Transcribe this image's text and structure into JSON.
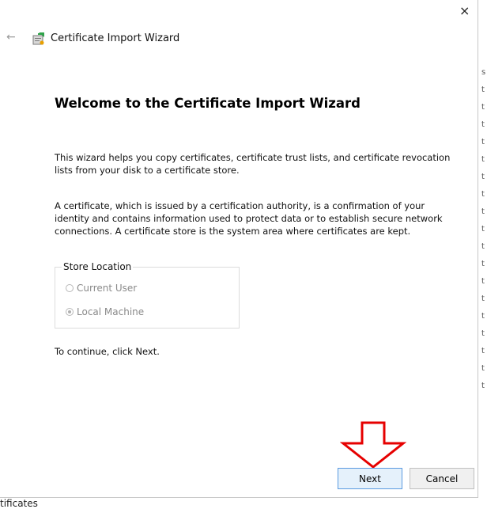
{
  "window": {
    "close_label": "×",
    "back_label": "←",
    "title": "Certificate Import Wizard"
  },
  "content": {
    "heading": "Welcome to the Certificate Import Wizard",
    "para1": "This wizard helps you copy certificates, certificate trust lists, and certificate revocation lists from your disk to a certificate store.",
    "para2": "A certificate, which is issued by a certification authority, is a confirmation of your identity and contains information used to protect data or to establish secure network connections. A certificate store is the system area where certificates are kept.",
    "store_location": {
      "legend": "Store Location",
      "options": [
        {
          "label": "Current User",
          "checked": false,
          "enabled": false
        },
        {
          "label": "Local Machine",
          "checked": true,
          "enabled": false
        }
      ]
    },
    "continue_text": "To continue, click Next."
  },
  "buttons": {
    "next": "Next",
    "cancel": "Cancel"
  },
  "background": {
    "right_edge_letters": [
      "s",
      "t",
      "t",
      "t",
      "t",
      "t",
      "t",
      "t",
      "t",
      "t",
      "t",
      "t",
      "t",
      "t",
      "t",
      "t",
      "t",
      "t",
      "t"
    ],
    "bottom_left_text": "tificates"
  },
  "colors": {
    "annotation_arrow": "#e60000",
    "next_button_border": "#5a9ae0",
    "next_button_fill": "#e5f1fb"
  }
}
